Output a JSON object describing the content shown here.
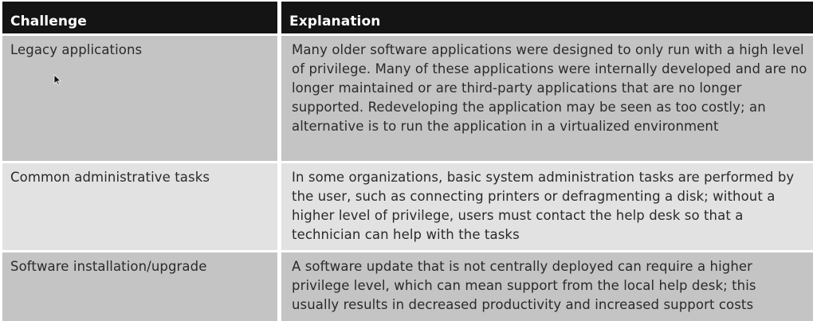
{
  "table": {
    "headers": [
      "Challenge",
      "Explanation"
    ],
    "rows": [
      {
        "challenge": "Legacy applications",
        "explanation": "Many older software applications were designed to only run with a high level of privilege. Many of these applications were internally developed and are no longer maintained or are third-party applications that are no longer supported. Redeveloping the application may be seen as too costly; an alternative is to run the application in a virtualized environment"
      },
      {
        "challenge": "Common administrative tasks",
        "explanation": "In some organizations, basic system administration tasks are performed by the user, such as connecting printers or defragmenting a disk; without a higher level of privilege, users must contact the help desk so that a technician can help with the tasks"
      },
      {
        "challenge": "Software installation/upgrade",
        "explanation": "A software update that is not centrally deployed can require a higher privilege level, which can mean support from the local help desk; this usually results in decreased productivity and increased support costs"
      }
    ]
  },
  "icons": {
    "cursor": "mouse-pointer-icon"
  },
  "colors": {
    "header_bg": "#141414",
    "row_dark": "#c4c4c4",
    "row_light": "#e2e2e2",
    "text": "#2a2a2a"
  }
}
